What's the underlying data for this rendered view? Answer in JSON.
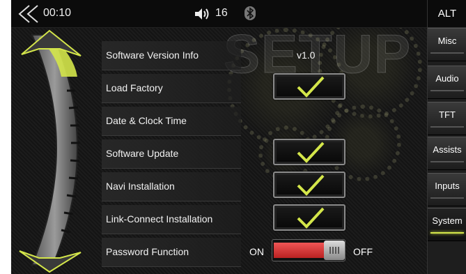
{
  "status": {
    "time": "00:10",
    "volume": "16"
  },
  "watermark": "SETUP",
  "tabs": {
    "alt": "ALT",
    "items": [
      {
        "label": "Misc"
      },
      {
        "label": "Audio"
      },
      {
        "label": "TFT"
      },
      {
        "label": "Assists"
      },
      {
        "label": "Inputs"
      },
      {
        "label": "System",
        "active": true
      }
    ]
  },
  "rows": {
    "software_version": {
      "label": "Software Version Info",
      "value": "v1.0"
    },
    "load_factory": {
      "label": "Load Factory",
      "checked": true
    },
    "date_clock": {
      "label": "Date & Clock Time"
    },
    "software_update": {
      "label": "Software Update",
      "checked": true
    },
    "navi_install": {
      "label": "Navi Installation",
      "checked": true
    },
    "link_connect": {
      "label": "Link-Connect Installation",
      "checked": true
    },
    "password": {
      "label": "Password Function",
      "on_label": "ON",
      "off_label": "OFF",
      "state": "ON"
    }
  },
  "colors": {
    "accent": "#d4e64a",
    "toggle_on": "#d83a3a"
  },
  "icons": {
    "back": "double-chevron-left-icon",
    "volume": "speaker-icon",
    "bluetooth": "bluetooth-icon",
    "check": "checkmark-icon"
  }
}
